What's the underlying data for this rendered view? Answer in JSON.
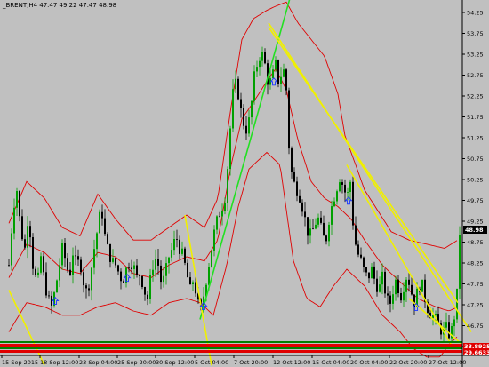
{
  "window": {
    "title": "_BRENT,H4  47.47 49.22 47.47 48.98"
  },
  "colors": {
    "background": "#c0c0c0",
    "bull_candle": "#00a000",
    "bear_candle": "#000000",
    "bollinger": "#e00000",
    "trend_green": "#22e022",
    "trend_yellow": "#f0f000",
    "fractal_arrow": "#1a38ff",
    "current_price_tag_bg": "#000000",
    "indicator_tag_bg": "#e00000"
  },
  "chart_data": {
    "type": "candlestick",
    "symbol": "_BRENT",
    "timeframe": "H4",
    "ohlc": {
      "open": 47.47,
      "high": 49.22,
      "low": 47.47,
      "close": 48.98
    },
    "current_price": "48.98",
    "indicator_labels": [
      "33.8925",
      "29.6633"
    ],
    "y_ticks": [
      "54.25",
      "53.75",
      "53.25",
      "52.75",
      "52.25",
      "51.75",
      "51.25",
      "50.75",
      "50.25",
      "49.75",
      "49.25",
      "48.75",
      "48.25",
      "47.75",
      "47.25",
      "46.75",
      "46.25"
    ],
    "x_ticks": [
      "15 Sep 2015",
      "18 Sep 12:00",
      "23 Sep 04:00",
      "25 Sep 20:00",
      "30 Sep 12:00",
      "5 Oct 04:00",
      "7 Oct 20:00",
      "12 Oct 12:00",
      "15 Oct 04:00",
      "20 Oct 04:00",
      "22 Oct 20:00",
      "27 Oct 12:00"
    ],
    "ylim": [
      46.25,
      54.25
    ],
    "price_path": [
      [
        0,
        48.2
      ],
      [
        5,
        49.6
      ],
      [
        9,
        50.0
      ],
      [
        13,
        49.1
      ],
      [
        18,
        48.6
      ],
      [
        22,
        49.5
      ],
      [
        27,
        48.2
      ],
      [
        32,
        47.7
      ],
      [
        36,
        48.4
      ],
      [
        40,
        47.8
      ],
      [
        44,
        47.4
      ],
      [
        48,
        47.2
      ],
      [
        52,
        47.6
      ],
      [
        56,
        48.1
      ],
      [
        60,
        48.6
      ],
      [
        64,
        48.3
      ],
      [
        68,
        47.9
      ],
      [
        72,
        48.5
      ],
      [
        76,
        48.2
      ],
      [
        80,
        48.3
      ],
      [
        84,
        47.8
      ],
      [
        88,
        47.5
      ],
      [
        92,
        48.0
      ],
      [
        96,
        48.6
      ],
      [
        100,
        49.1
      ],
      [
        104,
        49.6
      ],
      [
        108,
        48.9
      ],
      [
        112,
        48.5
      ],
      [
        116,
        48.3
      ],
      [
        120,
        48.2
      ],
      [
        124,
        48.0
      ],
      [
        128,
        47.8
      ],
      [
        132,
        48.1
      ],
      [
        136,
        48.3
      ],
      [
        140,
        48.2
      ],
      [
        144,
        47.9
      ],
      [
        148,
        48.0
      ],
      [
        152,
        47.6
      ],
      [
        156,
        47.4
      ],
      [
        160,
        48.0
      ],
      [
        164,
        48.4
      ],
      [
        168,
        48.2
      ],
      [
        172,
        47.7
      ],
      [
        176,
        48.0
      ],
      [
        180,
        48.4
      ],
      [
        184,
        48.6
      ],
      [
        188,
        48.9
      ],
      [
        192,
        48.6
      ],
      [
        196,
        48.4
      ],
      [
        200,
        48.0
      ],
      [
        204,
        47.6
      ],
      [
        208,
        47.9
      ],
      [
        212,
        47.3
      ],
      [
        216,
        47.1
      ],
      [
        220,
        47.6
      ],
      [
        224,
        48.1
      ],
      [
        228,
        48.6
      ],
      [
        232,
        49.1
      ],
      [
        236,
        49.4
      ],
      [
        240,
        49.6
      ],
      [
        244,
        49.9
      ],
      [
        248,
        51.2
      ],
      [
        252,
        52.3
      ],
      [
        256,
        52.6
      ],
      [
        260,
        52.0
      ],
      [
        264,
        51.6
      ],
      [
        268,
        51.4
      ],
      [
        272,
        51.9
      ],
      [
        276,
        52.7
      ],
      [
        280,
        53.1
      ],
      [
        284,
        53.3
      ],
      [
        288,
        53.0
      ],
      [
        292,
        52.5
      ],
      [
        296,
        52.7
      ],
      [
        300,
        53.0
      ],
      [
        304,
        52.5
      ],
      [
        308,
        53.0
      ],
      [
        312,
        52.4
      ],
      [
        316,
        50.6
      ],
      [
        320,
        50.2
      ],
      [
        324,
        50.0
      ],
      [
        328,
        49.8
      ],
      [
        332,
        49.4
      ],
      [
        336,
        49.0
      ],
      [
        340,
        48.9
      ],
      [
        344,
        49.2
      ],
      [
        348,
        49.3
      ],
      [
        352,
        49.0
      ],
      [
        356,
        48.7
      ],
      [
        360,
        49.3
      ],
      [
        364,
        49.7
      ],
      [
        368,
        50.0
      ],
      [
        372,
        50.3
      ],
      [
        376,
        50.1
      ],
      [
        380,
        49.8
      ],
      [
        384,
        50.2
      ],
      [
        388,
        48.9
      ],
      [
        392,
        48.5
      ],
      [
        396,
        48.3
      ],
      [
        400,
        48.0
      ],
      [
        404,
        47.9
      ],
      [
        408,
        48.1
      ],
      [
        412,
        47.8
      ],
      [
        416,
        47.6
      ],
      [
        420,
        47.9
      ],
      [
        424,
        47.5
      ],
      [
        428,
        47.2
      ],
      [
        432,
        47.6
      ],
      [
        436,
        47.9
      ],
      [
        440,
        47.4
      ],
      [
        444,
        47.7
      ],
      [
        448,
        48.0
      ],
      [
        452,
        47.6
      ],
      [
        456,
        47.3
      ],
      [
        460,
        47.6
      ],
      [
        464,
        47.8
      ],
      [
        468,
        47.4
      ],
      [
        472,
        47.1
      ],
      [
        476,
        47.0
      ],
      [
        480,
        46.9
      ],
      [
        484,
        46.7
      ],
      [
        488,
        46.6
      ],
      [
        492,
        46.7
      ],
      [
        496,
        46.5
      ],
      [
        500,
        46.8
      ],
      [
        504,
        47.5
      ],
      [
        507,
        48.98
      ]
    ],
    "bollinger_upper": [
      [
        0,
        49.2
      ],
      [
        20,
        50.2
      ],
      [
        40,
        49.8
      ],
      [
        60,
        49.1
      ],
      [
        80,
        48.9
      ],
      [
        100,
        49.9
      ],
      [
        120,
        49.3
      ],
      [
        140,
        48.8
      ],
      [
        160,
        48.8
      ],
      [
        180,
        49.1
      ],
      [
        200,
        49.4
      ],
      [
        220,
        49.1
      ],
      [
        235,
        49.8
      ],
      [
        250,
        52.0
      ],
      [
        262,
        53.6
      ],
      [
        275,
        54.1
      ],
      [
        290,
        54.3
      ],
      [
        300,
        54.4
      ],
      [
        312,
        54.5
      ],
      [
        325,
        54.0
      ],
      [
        340,
        53.6
      ],
      [
        355,
        53.2
      ],
      [
        370,
        52.3
      ],
      [
        378,
        51.3
      ],
      [
        390,
        50.6
      ],
      [
        400,
        50.0
      ],
      [
        415,
        49.5
      ],
      [
        430,
        49.0
      ],
      [
        450,
        48.8
      ],
      [
        470,
        48.7
      ],
      [
        490,
        48.6
      ],
      [
        505,
        48.8
      ]
    ],
    "bollinger_mid": [
      [
        0,
        47.9
      ],
      [
        20,
        48.7
      ],
      [
        40,
        48.5
      ],
      [
        60,
        48.1
      ],
      [
        80,
        48.0
      ],
      [
        100,
        48.5
      ],
      [
        120,
        48.4
      ],
      [
        140,
        48.0
      ],
      [
        160,
        47.9
      ],
      [
        180,
        48.2
      ],
      [
        200,
        48.4
      ],
      [
        220,
        48.3
      ],
      [
        235,
        48.8
      ],
      [
        250,
        50.6
      ],
      [
        262,
        51.7
      ],
      [
        275,
        52.1
      ],
      [
        290,
        52.6
      ],
      [
        300,
        52.9
      ],
      [
        312,
        52.4
      ],
      [
        325,
        51.2
      ],
      [
        340,
        50.2
      ],
      [
        355,
        49.8
      ],
      [
        370,
        49.6
      ],
      [
        385,
        49.3
      ],
      [
        400,
        48.8
      ],
      [
        420,
        48.2
      ],
      [
        440,
        47.8
      ],
      [
        460,
        47.4
      ],
      [
        480,
        47.2
      ],
      [
        495,
        47.1
      ],
      [
        505,
        47.2
      ]
    ],
    "bollinger_lower": [
      [
        0,
        46.6
      ],
      [
        20,
        47.3
      ],
      [
        40,
        47.2
      ],
      [
        60,
        47.0
      ],
      [
        80,
        47.0
      ],
      [
        100,
        47.2
      ],
      [
        120,
        47.3
      ],
      [
        140,
        47.1
      ],
      [
        160,
        47.0
      ],
      [
        180,
        47.3
      ],
      [
        200,
        47.4
      ],
      [
        215,
        47.3
      ],
      [
        230,
        47.0
      ],
      [
        245,
        48.2
      ],
      [
        258,
        49.6
      ],
      [
        270,
        50.5
      ],
      [
        290,
        50.9
      ],
      [
        305,
        50.6
      ],
      [
        320,
        48.3
      ],
      [
        335,
        47.4
      ],
      [
        350,
        47.2
      ],
      [
        365,
        47.7
      ],
      [
        380,
        48.1
      ],
      [
        400,
        47.7
      ],
      [
        420,
        47.0
      ],
      [
        440,
        46.6
      ],
      [
        455,
        46.2
      ],
      [
        470,
        46.0
      ],
      [
        485,
        46.0
      ],
      [
        495,
        46.3
      ],
      [
        505,
        46.5
      ]
    ],
    "green_line": [
      [
        215,
        46.9
      ],
      [
        328,
        55.5
      ]
    ],
    "yellow_lines": [
      [
        [
          0,
          47.6
        ],
        [
          40,
          45.8
        ]
      ],
      [
        [
          198,
          49.4
        ],
        [
          228,
          45.8
        ]
      ],
      [
        [
          292,
          54.0
        ],
        [
          520,
          46.6
        ]
      ],
      [
        [
          292,
          53.9
        ],
        [
          505,
          47.3
        ]
      ],
      [
        [
          380,
          50.6
        ],
        [
          500,
          46.2
        ]
      ],
      [
        [
          450,
          47.4
        ],
        [
          510,
          46.3
        ]
      ]
    ],
    "fractal_arrows_x": [
      52,
      133,
      219,
      298,
      382,
      458
    ]
  }
}
